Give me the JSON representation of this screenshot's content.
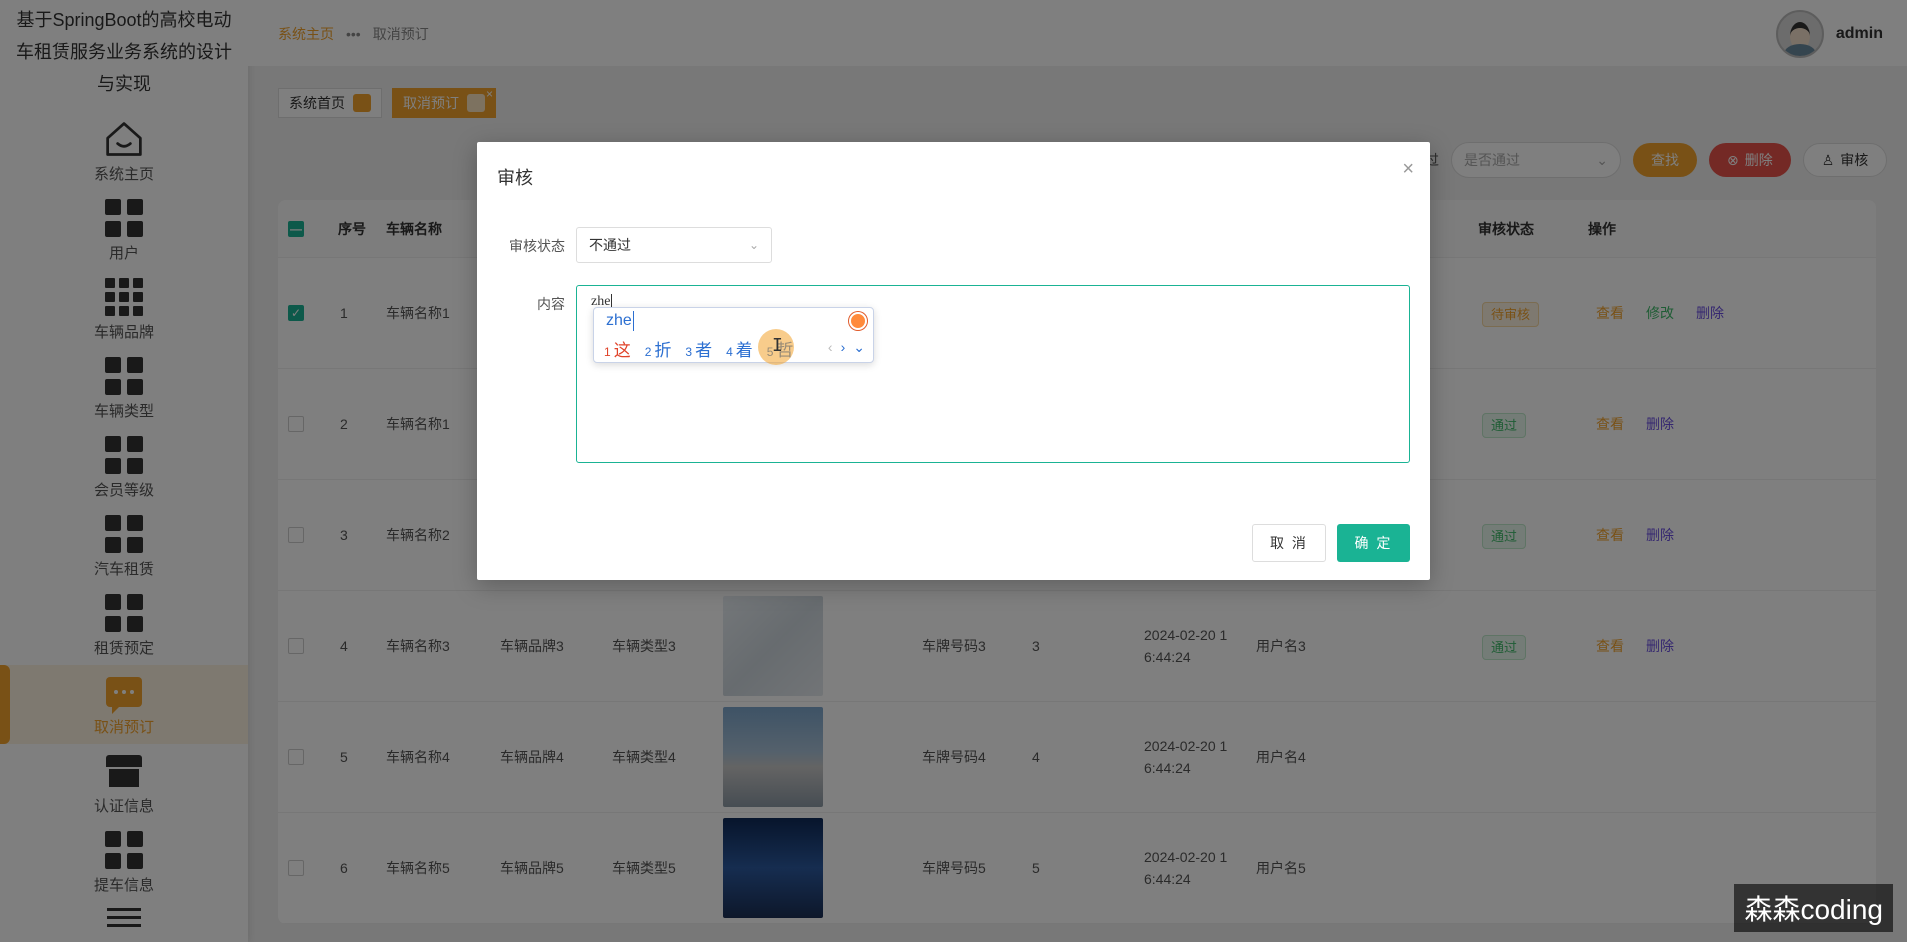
{
  "sidebar": {
    "title": "基于SpringBoot的高校电动车租赁服务业务系统的设计与实现",
    "items": [
      {
        "label": "系统主页",
        "icon": "home-icon"
      },
      {
        "label": "用户",
        "icon": "grid-icon"
      },
      {
        "label": "车辆品牌",
        "icon": "grid9-icon"
      },
      {
        "label": "车辆类型",
        "icon": "grid-icon"
      },
      {
        "label": "会员等级",
        "icon": "grid-icon"
      },
      {
        "label": "汽车租赁",
        "icon": "grid-icon"
      },
      {
        "label": "租赁预定",
        "icon": "grid-icon"
      },
      {
        "label": "取消预订",
        "icon": "chat-icon"
      },
      {
        "label": "认证信息",
        "icon": "store-icon"
      },
      {
        "label": "提车信息",
        "icon": "grid-icon"
      }
    ]
  },
  "header": {
    "breadcrumb_home": "系统主页",
    "breadcrumb_sep": "•••",
    "breadcrumb_current": "取消预订",
    "username": "admin"
  },
  "tags": {
    "home": "系统首页",
    "current": "取消预订",
    "close": "×"
  },
  "filter": {
    "label_fragment": "过",
    "select_placeholder": "是否通过",
    "find": "查找",
    "delete": "删除",
    "audit": "审核"
  },
  "table": {
    "headers": {
      "index": "序号",
      "name": "车辆名称",
      "status": "审核状态",
      "action": "操作"
    },
    "rows": [
      {
        "idx": "1",
        "name": "车辆名称1",
        "brand": "",
        "type": "",
        "plate": "",
        "qty": "",
        "time": "",
        "user": "",
        "status": "待审核",
        "ops": [
          "查看",
          "修改",
          "删除"
        ],
        "checked": true
      },
      {
        "idx": "2",
        "name": "车辆名称1",
        "brand": "",
        "type": "",
        "plate": "",
        "qty": "",
        "time": "",
        "user": "",
        "status": "通过",
        "ops": [
          "查看",
          "删除"
        ],
        "checked": false
      },
      {
        "idx": "3",
        "name": "车辆名称2",
        "brand": "",
        "type": "",
        "plate": "",
        "qty": "",
        "time": "",
        "user": "",
        "status": "通过",
        "ops": [
          "查看",
          "删除"
        ],
        "checked": false
      },
      {
        "idx": "4",
        "name": "车辆名称3",
        "brand": "车辆品牌3",
        "type": "车辆类型3",
        "plate": "车牌号码3",
        "qty": "3",
        "time": "2024-02-20 16:44:24",
        "user": "用户名3",
        "status": "通过",
        "ops": [
          "查看",
          "删除"
        ],
        "checked": false
      },
      {
        "idx": "5",
        "name": "车辆名称4",
        "brand": "车辆品牌4",
        "type": "车辆类型4",
        "plate": "车牌号码4",
        "qty": "4",
        "time": "2024-02-20 16:44:24",
        "user": "用户名4",
        "status": "",
        "ops": [],
        "checked": false
      },
      {
        "idx": "6",
        "name": "车辆名称5",
        "brand": "车辆品牌5",
        "type": "车辆类型5",
        "plate": "车牌号码5",
        "qty": "5",
        "time": "2024-02-20 16:44:24",
        "user": "用户名5",
        "status": "",
        "ops": [],
        "checked": false
      }
    ]
  },
  "dialog": {
    "title": "审核",
    "close": "×",
    "status_label": "审核状态",
    "status_value": "不通过",
    "content_label": "内容",
    "content_value": "zhe",
    "cancel": "取 消",
    "ok": "确 定"
  },
  "ime": {
    "composition": "zhe",
    "candidates": [
      {
        "n": "1",
        "text": "这"
      },
      {
        "n": "2",
        "text": "折"
      },
      {
        "n": "3",
        "text": "者"
      },
      {
        "n": "4",
        "text": "着"
      },
      {
        "n": "5",
        "text": "哲"
      }
    ],
    "prev": "‹",
    "next": "›",
    "more": "⌄"
  },
  "watermark": "森森coding",
  "colors": {
    "accent": "#f2a32c",
    "primary": "#1ab394",
    "danger": "#e8524a"
  }
}
